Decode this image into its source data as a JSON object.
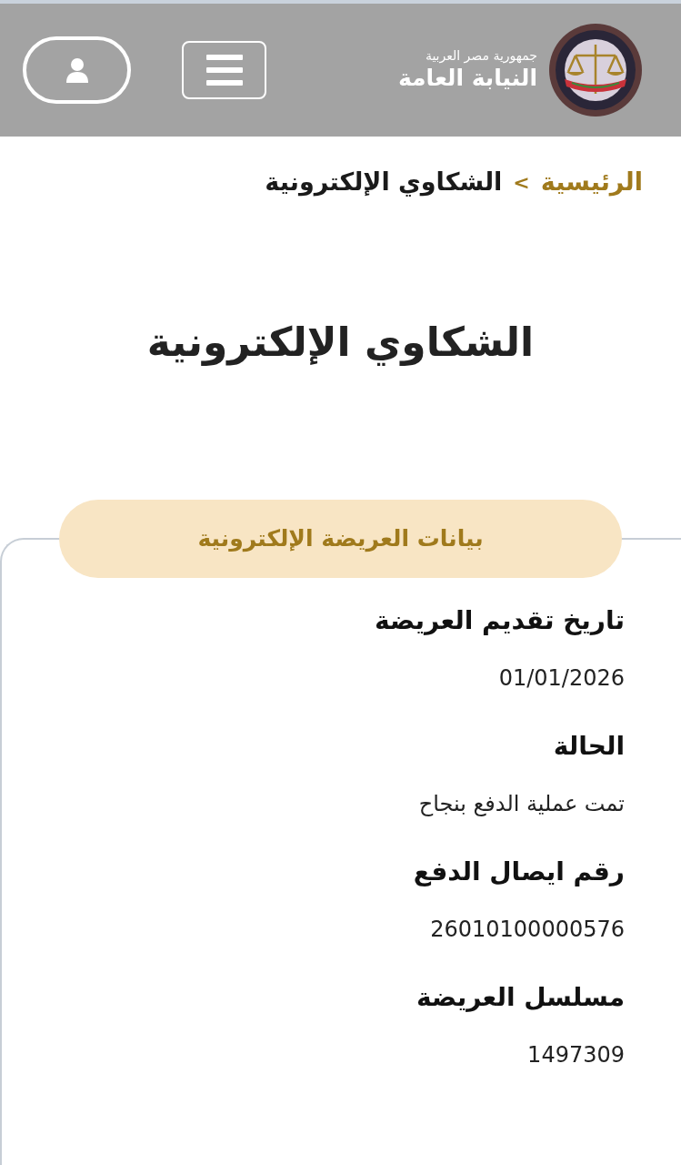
{
  "header": {
    "subtitle": "جمهورية مصر العربية",
    "title": "النيابة العامة"
  },
  "breadcrumb": [
    {
      "label": "الرئيسية",
      "kind": "link"
    },
    {
      "label": "الشكاوي الإلكترونية",
      "kind": "current"
    }
  ],
  "breadcrumb_separator": ">",
  "page_title": "الشكاوي الإلكترونية",
  "section": {
    "title": "بيانات العريضة الإلكترونية",
    "fields": [
      {
        "label": "تاريخ تقديم العريضة",
        "value": "01/01/2026"
      },
      {
        "label": "الحالة",
        "value": "تمت عملية الدفع بنجاح"
      },
      {
        "label": "رقم ايصال الدفع",
        "value": "26010100000576"
      },
      {
        "label": "مسلسل العريضة",
        "value": "1497309"
      }
    ]
  }
}
